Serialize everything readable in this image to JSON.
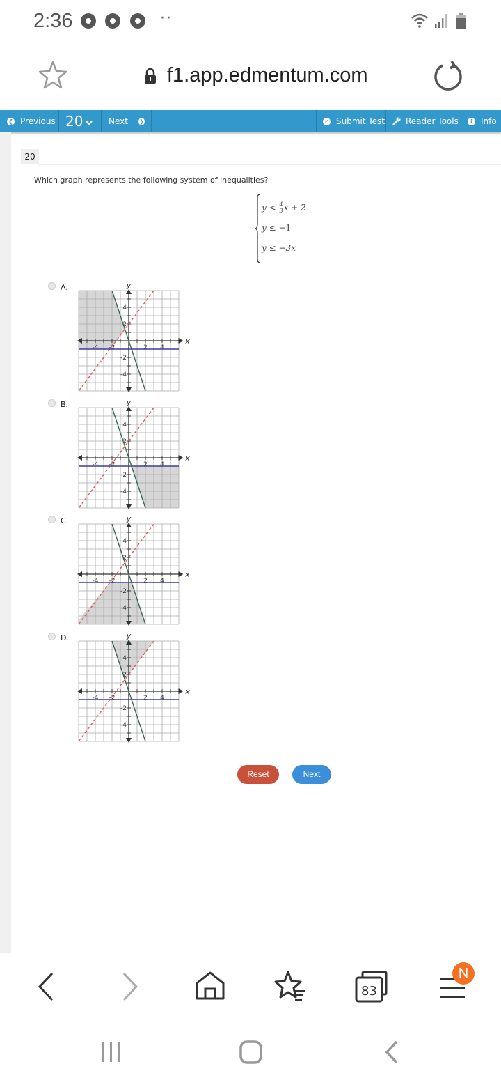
{
  "status_bar": {
    "time": "2:36",
    "notification_icons": [
      "chrome-icon",
      "chrome-icon",
      "chrome-icon"
    ],
    "more_indicator": "··",
    "system_icons": [
      "wifi-icon",
      "signal-icon",
      "battery-icon"
    ]
  },
  "browser": {
    "url": "f1.app.edmentum.com",
    "tab_count": "83",
    "menu_badge": "N"
  },
  "toolbar": {
    "previous_label": "Previous",
    "question_selector": "20",
    "next_label": "Next",
    "submit_label": "Submit Test",
    "reader_tools_label": "Reader Tools",
    "info_label": "Info"
  },
  "question": {
    "number": "20",
    "prompt": "Which graph represents the following system of inequalities?",
    "system": [
      {
        "lhs": "y",
        "op": "<",
        "frac_num": "4",
        "frac_den": "3",
        "rhs_tail": "x + 2"
      },
      {
        "lhs": "y",
        "op": "≤",
        "rhs": "−1"
      },
      {
        "lhs": "y",
        "op": "≤",
        "rhs": "−3x"
      }
    ]
  },
  "options": [
    {
      "letter": "A.",
      "shaded_region": "upper-left: above y=-1, left of y=-3x, above y=4/3x+2"
    },
    {
      "letter": "B.",
      "shaded_region": "lower-right: below y=-1, right of y=-3x"
    },
    {
      "letter": "C.",
      "shaded_region": "below y=-1, left of y=-3x, below y=4/3x+2"
    },
    {
      "letter": "D.",
      "shaded_region": "top: above y=-3x, above y=4/3x+2"
    }
  ],
  "graph": {
    "x_label": "x",
    "y_label": "y",
    "x_ticks": [
      "-4",
      "-2",
      "2",
      "4"
    ],
    "y_ticks": [
      "4",
      "2",
      "-2",
      "-4"
    ],
    "range": [
      -6,
      6
    ],
    "lines": [
      {
        "name": "y = 4/3x + 2",
        "slope": 1.3333,
        "intercept": 2,
        "style": "dashed",
        "color": "#e05a5a"
      },
      {
        "name": "y = -1",
        "slope": 0,
        "intercept": -1,
        "style": "solid",
        "color": "#3d3d9e"
      },
      {
        "name": "y = -3x",
        "slope": -3,
        "intercept": 0,
        "style": "solid",
        "color": "#3a6650"
      }
    ],
    "shade_color": "#d6d6d6"
  },
  "actions": {
    "reset_label": "Reset",
    "next_label": "Next"
  },
  "colors": {
    "toolbar": "#3398cc",
    "reset": "#c9513a",
    "next": "#3b8fd8",
    "badge": "#f37121"
  }
}
